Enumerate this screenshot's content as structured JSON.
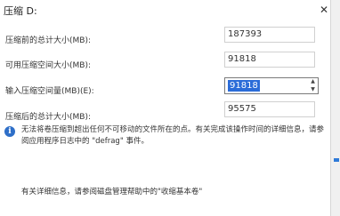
{
  "window": {
    "title": "压缩 D:",
    "close_glyph": "✕"
  },
  "fields": {
    "total_before_label": "压缩前的总计大小(MB):",
    "total_before_value": "187393",
    "available_label": "可用压缩空间大小(MB):",
    "available_value": "91818",
    "input_label": "输入压缩空间量(MB)(E):",
    "input_value": "91818",
    "total_after_label": "压缩后的总计大小(MB):",
    "total_after_value": "95575"
  },
  "info": {
    "icon": "info-icon",
    "icon_glyph": "i",
    "text": "无法将卷压缩到超出任何不可移动的文件所在的点。有关完成该操作时间的详细信息，请参阅应用程序日志中的 \"defrag\" 事件。",
    "help": "有关详细信息，请参阅磁盘管理帮助中的\"收缩基本卷\""
  },
  "spinner": {
    "up_glyph": "▲",
    "down_glyph": "▼"
  },
  "colors": {
    "selection": "#2b6cd8",
    "info_icon": "#2e6fc8"
  }
}
